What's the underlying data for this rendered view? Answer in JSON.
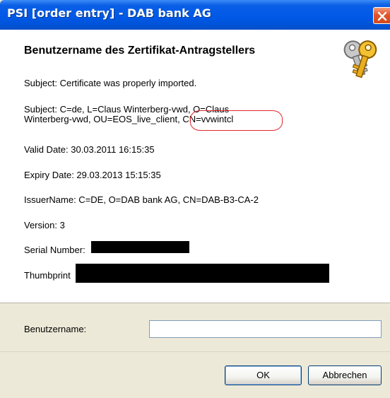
{
  "window": {
    "title": "PSI [order entry] - DAB bank AG",
    "close_icon": "close-icon"
  },
  "dialog": {
    "heading": "Benutzername des Zertifikat-Antragstellers",
    "icon": "keys-icon",
    "lines": {
      "status": "Subject: Certificate was properly imported.",
      "subject_line1": "Subject: C=de, L=Claus Winterberg-vwd, O=Claus",
      "subject_line2": "Winterberg-vwd, OU=EOS_live_client, CN=vvwintcl",
      "valid_date": "Valid Date: 30.03.2011 16:15:35",
      "expiry_date": "Expiry Date: 29.03.2013 15:15:35",
      "issuer": "IssuerName: C=DE, O=DAB bank AG, CN=DAB-B3-CA-2",
      "version": "Version: 3",
      "serial_label": "Serial Number:",
      "thumbprint_label": "Thumbprint"
    },
    "highlight_color": "#e0292e"
  },
  "form": {
    "username_label": "Benutzername:",
    "username_value": ""
  },
  "buttons": {
    "ok": "OK",
    "cancel": "Abbrechen"
  }
}
